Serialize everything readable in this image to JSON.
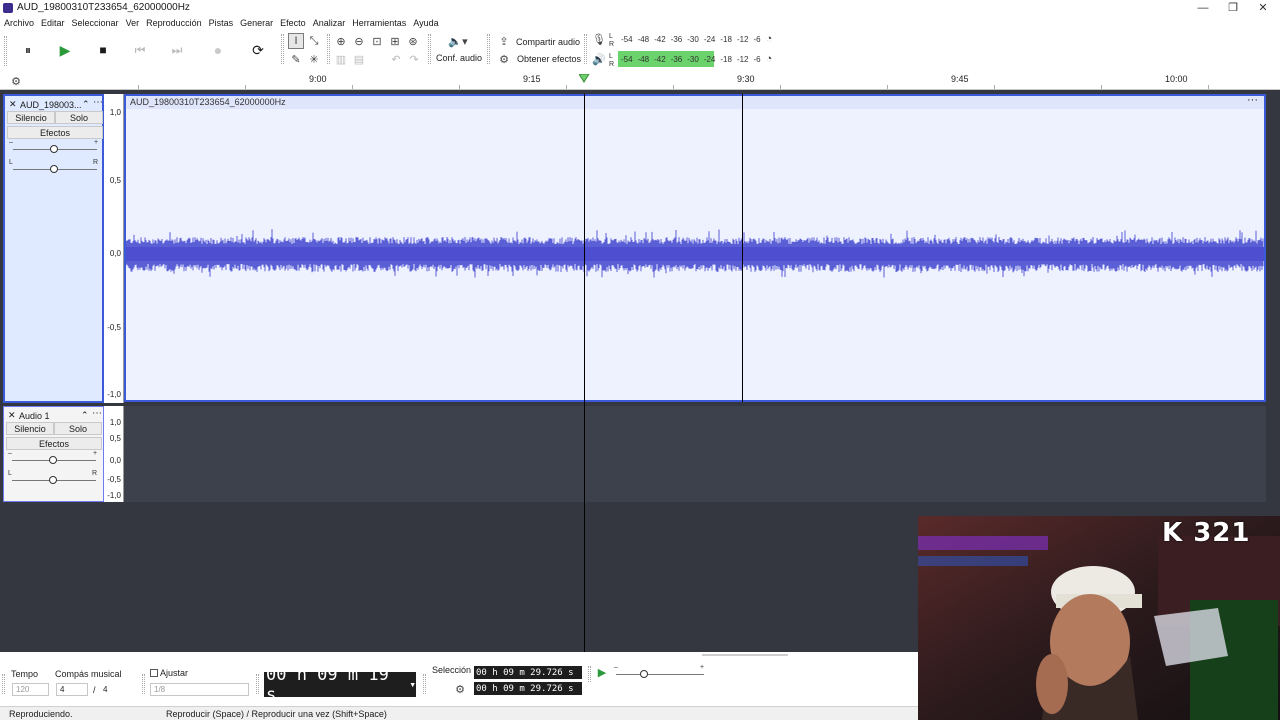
{
  "window": {
    "title": "AUD_19800310T233654_62000000Hz",
    "minimize": "—",
    "restore": "❐",
    "close": "✕"
  },
  "menu": [
    "Archivo",
    "Editar",
    "Seleccionar",
    "Ver",
    "Reproducción",
    "Pistas",
    "Generar",
    "Efecto",
    "Analizar",
    "Herramientas",
    "Ayuda"
  ],
  "toolbar": {
    "pause": "⏸",
    "play": "▶",
    "stop": "■",
    "skip_start": "⏮",
    "skip_end": "⏭",
    "record": "●",
    "loop": "⟳",
    "conf_audio": "Conf. audio",
    "share_audio": "Compartir audio",
    "get_effects": "Obtener efectos",
    "meter_scale": [
      "-54",
      "-48",
      "-42",
      "-36",
      "-30",
      "-24",
      "-18",
      "-12",
      "-6"
    ],
    "rec_lr": "L\nR"
  },
  "ruler": {
    "ticks": [
      "9:00",
      "9:15",
      "9:30",
      "9:45",
      "10:00"
    ]
  },
  "tracks": [
    {
      "name": "AUD_198003...",
      "clip_title": "AUD_19800310T233654_62000000Hz",
      "mute": "Silencio",
      "solo": "Solo",
      "effects": "Efectos",
      "scale": [
        "1,0",
        "0,5",
        "0,0",
        "-0,5",
        "-1,0"
      ]
    },
    {
      "name": "Audio 1",
      "mute": "Silencio",
      "solo": "Solo",
      "effects": "Efectos",
      "scale": [
        "1,0",
        "0,5",
        "0,0",
        "-0,5",
        "-1,0"
      ]
    }
  ],
  "bottom": {
    "tempo_label": "Tempo",
    "tempo_value": "120",
    "time_sig_label": "Compás musical",
    "time_sig_num": "4",
    "time_sig_sep": "/",
    "time_sig_den": "4",
    "snap_label": "Ajustar",
    "snap_value": "1/8",
    "time_display": "00 h 09 m 19 s",
    "selection_label": "Selección",
    "sel_start": "00 h 09 m 29.726 s",
    "sel_end": "00 h 09 m 29.726 s"
  },
  "status": {
    "left": "Reproduciendo.",
    "hint": "Reproducir (Space) / Reproducir una vez (Shift+Space)"
  },
  "overlay": {
    "counter": "K 321"
  }
}
